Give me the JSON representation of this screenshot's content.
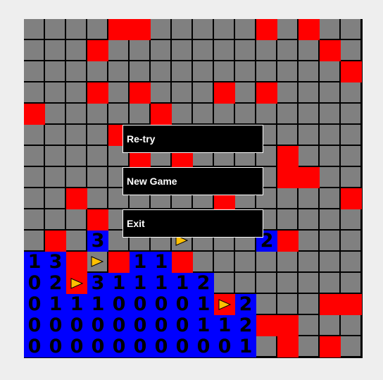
{
  "game": {
    "rows": 16,
    "cols": 16,
    "state": "lost",
    "colors": {
      "hidden": "#808080",
      "mine": "#ff0000",
      "revealed": "#0000ff",
      "flag": "#ffc000",
      "grid": "#000000",
      "background": "#eeeeee"
    },
    "legend": {
      "H": "hidden",
      "M": "mine",
      "F": "flag on hidden",
      "X": "flag on mine",
      "E": "revealed empty",
      "0-8": "revealed number"
    },
    "grid": [
      [
        "H",
        "H",
        "H",
        "H",
        "M",
        "M",
        "H",
        "H",
        "H",
        "H",
        "H",
        "M",
        "H",
        "M",
        "H",
        "H"
      ],
      [
        "H",
        "H",
        "H",
        "M",
        "H",
        "H",
        "H",
        "H",
        "H",
        "H",
        "H",
        "H",
        "H",
        "H",
        "M",
        "H"
      ],
      [
        "H",
        "H",
        "H",
        "H",
        "H",
        "H",
        "H",
        "H",
        "H",
        "H",
        "H",
        "H",
        "H",
        "H",
        "H",
        "M"
      ],
      [
        "H",
        "H",
        "H",
        "M",
        "H",
        "M",
        "H",
        "H",
        "H",
        "M",
        "H",
        "M",
        "H",
        "H",
        "H",
        "H"
      ],
      [
        "M",
        "H",
        "H",
        "H",
        "H",
        "H",
        "M",
        "H",
        "H",
        "H",
        "H",
        "H",
        "H",
        "H",
        "H",
        "H"
      ],
      [
        "H",
        "H",
        "H",
        "H",
        "M",
        "H",
        "H",
        "H",
        "H",
        "H",
        "H",
        "H",
        "H",
        "H",
        "H",
        "H"
      ],
      [
        "H",
        "H",
        "H",
        "H",
        "H",
        "M",
        "H",
        "M",
        "H",
        "H",
        "H",
        "H",
        "M",
        "H",
        "H",
        "H"
      ],
      [
        "H",
        "H",
        "H",
        "H",
        "H",
        "H",
        "H",
        "H",
        "H",
        "H",
        "H",
        "H",
        "M",
        "M",
        "H",
        "H"
      ],
      [
        "H",
        "H",
        "M",
        "H",
        "H",
        "H",
        "H",
        "H",
        "H",
        "M",
        "H",
        "H",
        "H",
        "H",
        "H",
        "M"
      ],
      [
        "H",
        "H",
        "H",
        "M",
        "H",
        "H",
        "H",
        "H",
        "H",
        "H",
        "H",
        "H",
        "H",
        "H",
        "H",
        "H"
      ],
      [
        "H",
        "M",
        "H",
        "3",
        "H",
        "H",
        "H",
        "F",
        "H",
        "H",
        "H",
        "2",
        "M",
        "H",
        "H",
        "H"
      ],
      [
        "1",
        "3",
        "M",
        "F",
        "M",
        "1",
        "1",
        "M",
        "H",
        "H",
        "H",
        "H",
        "H",
        "H",
        "H",
        "H"
      ],
      [
        "0",
        "2",
        "X",
        "3",
        "1",
        "1",
        "1",
        "1",
        "2",
        "H",
        "H",
        "H",
        "H",
        "H",
        "H",
        "H"
      ],
      [
        "0",
        "1",
        "1",
        "1",
        "0",
        "0",
        "0",
        "0",
        "1",
        "X",
        "2",
        "H",
        "H",
        "H",
        "M",
        "M"
      ],
      [
        "0",
        "0",
        "0",
        "0",
        "0",
        "0",
        "0",
        "0",
        "1",
        "1",
        "2",
        "M",
        "M",
        "H",
        "H",
        "H"
      ],
      [
        "0",
        "0",
        "0",
        "0",
        "0",
        "0",
        "0",
        "0",
        "0",
        "0",
        "1",
        "H",
        "M",
        "H",
        "M",
        "H"
      ]
    ]
  },
  "menu": {
    "buttons": [
      {
        "id": "retry",
        "label": "Re-try"
      },
      {
        "id": "new-game",
        "label": "New Game"
      },
      {
        "id": "exit",
        "label": "Exit"
      }
    ]
  }
}
